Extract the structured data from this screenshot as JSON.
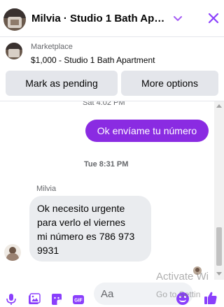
{
  "header": {
    "title": "Milvia · Studio 1 Bath Apar…",
    "accent": "#8a3ffc"
  },
  "listing": {
    "label": "Marketplace",
    "title": "$1,000 - Studio 1 Bath Apartment"
  },
  "actions": {
    "mark_pending": "Mark as pending",
    "more_options": "More options"
  },
  "messages": {
    "top_timestamp": "Sat 4:02 PM",
    "outgoing": "Ok envíame tu número",
    "outgoing_color": "#8a2be2",
    "divider_timestamp": "Tue 8:31 PM",
    "sender_name": "Milvia",
    "incoming": "Ok necesito urgente\npara verlo el viernes\nmi número  es 786 973\n9931"
  },
  "composer": {
    "placeholder": "Aa",
    "icons": [
      "microphone-icon",
      "image-icon",
      "sticker-icon",
      "gif-icon",
      "emoji-icon",
      "like-icon"
    ]
  },
  "watermark": {
    "line1": "Activate Wi",
    "line2": "Go to Settin"
  }
}
